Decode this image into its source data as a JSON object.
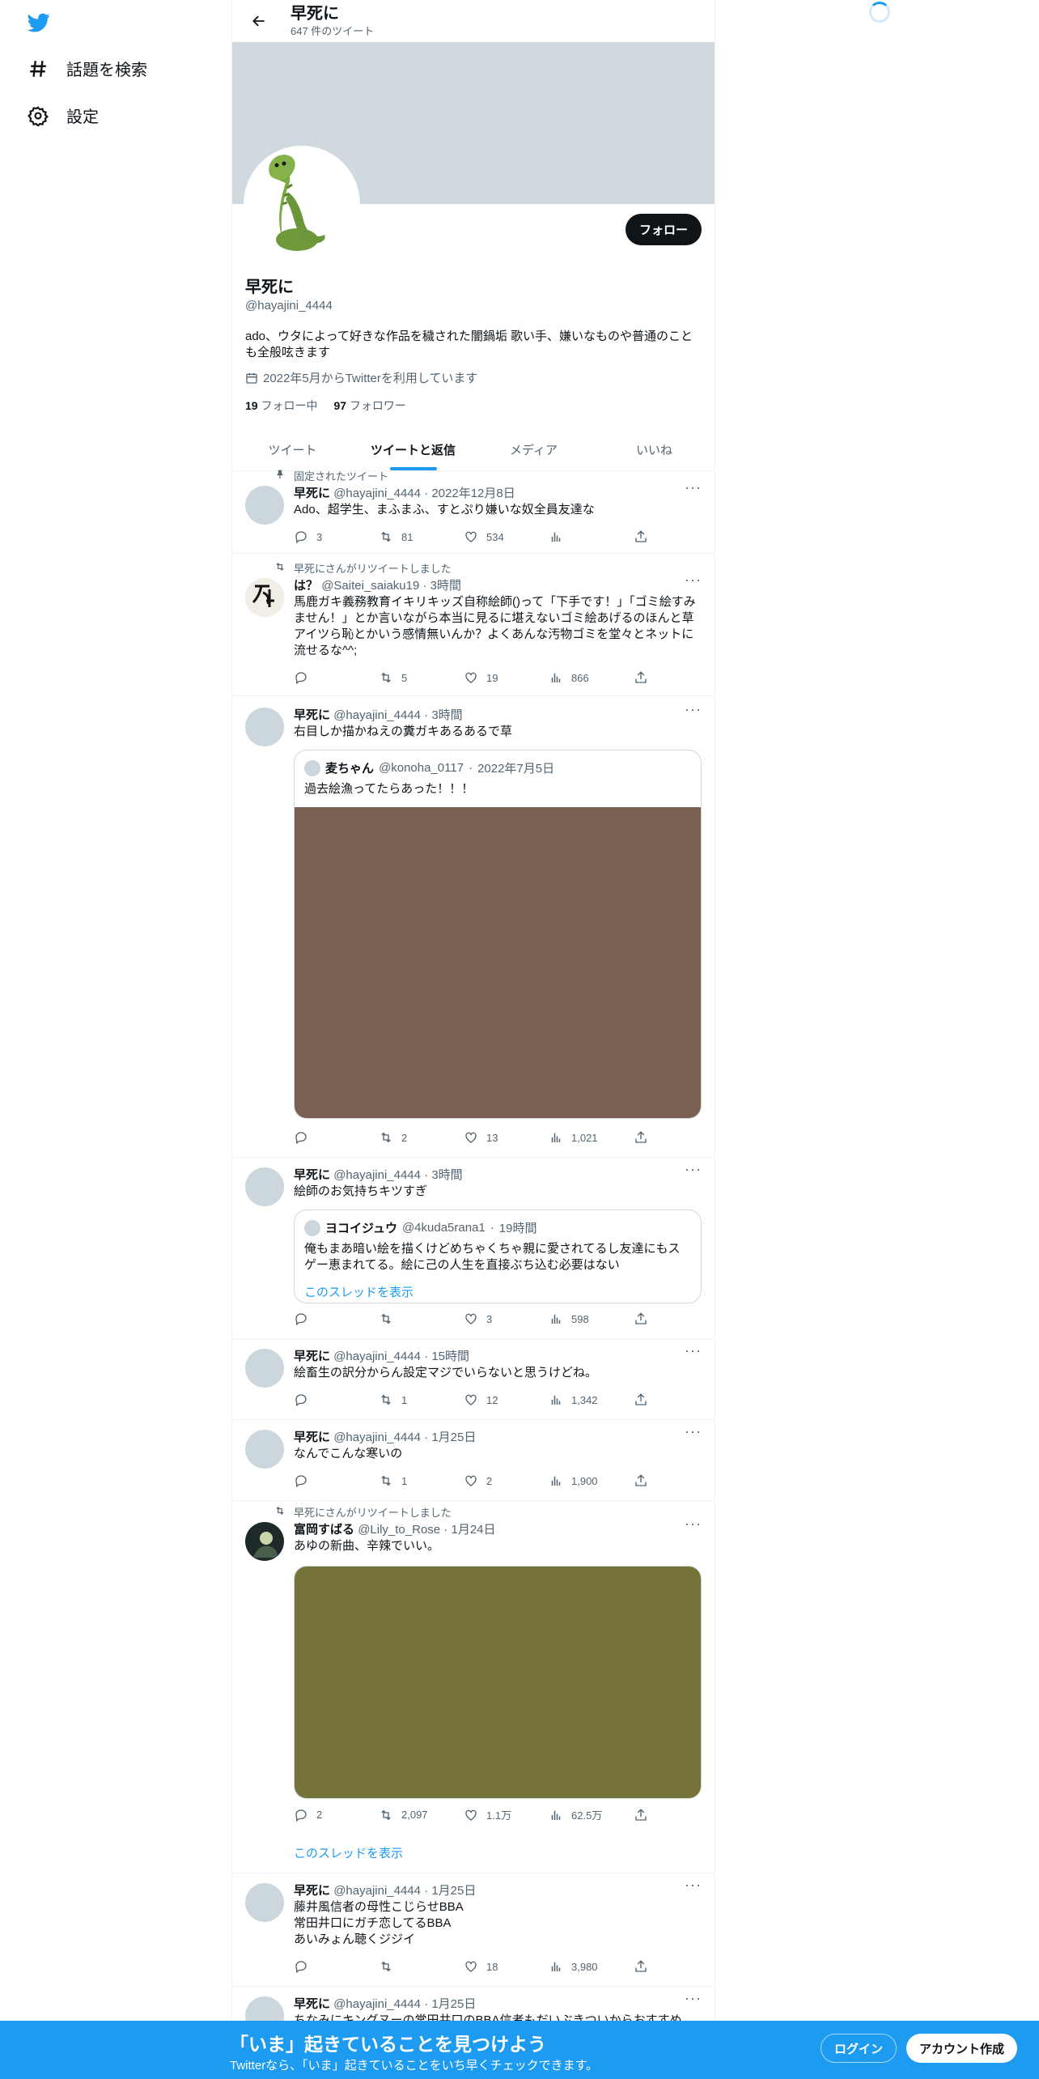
{
  "nav": {
    "explore_label": "話題を検索",
    "settings_label": "設定"
  },
  "header": {
    "name": "早死に",
    "tweet_count": "647 件のツイート"
  },
  "profile": {
    "follow_label": "フォロー",
    "name": "早死に",
    "handle": "@hayajini_4444",
    "bio": "ado、ウタによって好きな作品を穢された闇鍋垢 歌い手、嫌いなものや普通のことも全般呟きます",
    "joined": "2022年5月からTwitterを利用しています",
    "following_count": "19",
    "following_label": "フォロー中",
    "followers_count": "97",
    "followers_label": "フォロワー"
  },
  "tabs": [
    "ツイート",
    "ツイートと返信",
    "メディア",
    "いいね"
  ],
  "tweets": [
    {
      "context": "固定されたツイート",
      "name": "早死に",
      "handle": "@hayajini_4444",
      "time": "2022年12月8日",
      "text": "Ado、超学生、まふまふ、すとぷり嫌いな奴全員友達な",
      "replies": "3",
      "retweets": "81",
      "likes": "534",
      "views": ""
    },
    {
      "context": "早死にさんがリツイートしました",
      "name": "は？",
      "handle": "@Saitei_saiaku19",
      "time": "3時間",
      "text": "馬鹿ガキ義務教育イキリキッズ自称絵師()って「下手です！」「ゴミ絵すみません！」とか言いながら本当に見るに堪えないゴミ絵あげるのほんと草\nアイツら恥とかいう感情無いんか？よくあんな汚物ゴミを堂々とネットに流せるな^^;",
      "replies": "",
      "retweets": "5",
      "likes": "19",
      "views": "866"
    },
    {
      "name": "早死に",
      "handle": "@hayajini_4444",
      "time": "3時間",
      "text": "右目しか描かねえの糞ガキあるあるで草",
      "quote": {
        "name": "麦ちゃん",
        "handle": "@konoha_0117",
        "time": "2022年7月5日",
        "text": "過去絵漁ってたらあった！！！"
      },
      "media_color": "#7a6052",
      "replies": "",
      "retweets": "2",
      "likes": "13",
      "views": "1,021"
    },
    {
      "name": "早死に",
      "handle": "@hayajini_4444",
      "time": "3時間",
      "text": "絵師のお気持ちキツすぎ",
      "quote": {
        "name": "ヨコイジュウ",
        "handle": "@4kuda5rana1",
        "time": "19時間",
        "text": "俺もまあ暗い絵を描くけどめちゃくちゃ親に愛されてるし友達にもスゲー恵まれてる。絵に己の人生を直接ぶち込む必要はない",
        "link": "このスレッドを表示"
      },
      "replies": "",
      "retweets": "",
      "likes": "3",
      "views": "598"
    },
    {
      "name": "早死に",
      "handle": "@hayajini_4444",
      "time": "15時間",
      "text": "絵畜生の訳分からん設定マジでいらないと思うけどね。",
      "replies": "",
      "retweets": "1",
      "likes": "12",
      "views": "1,342"
    },
    {
      "name": "早死に",
      "handle": "@hayajini_4444",
      "time": "1月25日",
      "text": "なんでこんな寒いの",
      "replies": "",
      "retweets": "1",
      "likes": "2",
      "views": "1,900"
    },
    {
      "context": "早死にさんがリツイートしました",
      "name": "富岡すばる",
      "handle": "@Lily_to_Rose",
      "time": "1月24日",
      "text": "あゆの新曲、辛辣でいい。",
      "media_color": "#76733a",
      "replies": "2",
      "retweets": "2,097",
      "likes": "1.1万",
      "views": "62.5万",
      "thread_link": "このスレッドを表示"
    },
    {
      "name": "早死に",
      "handle": "@hayajini_4444",
      "time": "1月25日",
      "text": "藤井風信者の母性こじらせBBA\n常田井口にガチ恋してるBBA\nあいみょん聴くジジイ",
      "replies": "",
      "retweets": "",
      "likes": "18",
      "views": "3,980"
    },
    {
      "name": "早死に",
      "handle": "@hayajini_4444",
      "time": "1月25日",
      "text": "ちなみにキングヌーの常田井口のBBA信者もだいぶきついからおすすめ"
    }
  ],
  "bottom_bar": {
    "title": "「いま」起きていることを見つけよう",
    "subtitle": "Twitterなら、「いま」起きていることをいち早くチェックできます。",
    "login_label": "ログイン",
    "signup_label": "アカウント作成"
  },
  "colors": {
    "accent": "#1d9bf0",
    "text": "#0f1419",
    "muted": "#536471"
  }
}
